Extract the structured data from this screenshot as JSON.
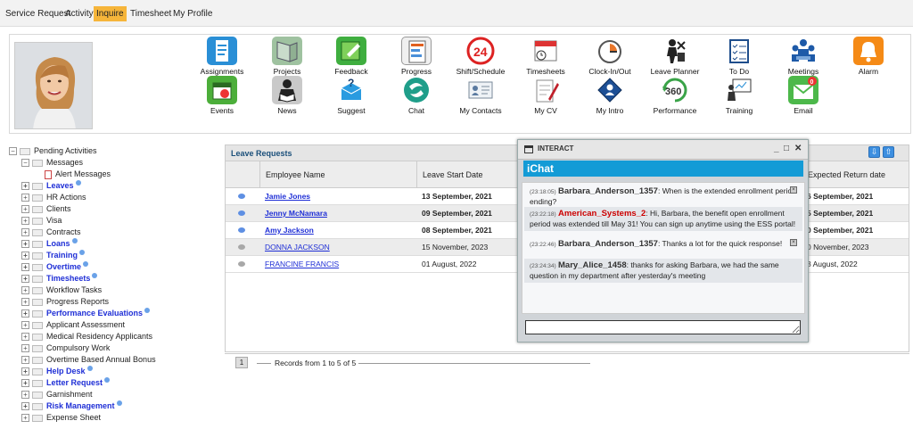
{
  "topnav": {
    "items": [
      "Service Request",
      "Activity",
      "Inquire",
      "Timesheet",
      "My Profile"
    ],
    "active_index": 2
  },
  "dashboard": {
    "row1": [
      "Assignments",
      "Projects",
      "Feedback",
      "Progress",
      "Shift/Schedule",
      "Timesheets",
      "Clock-In/Out",
      "Leave Planner",
      "To Do",
      "Meetings",
      "Alarm"
    ],
    "row2": [
      "Events",
      "News",
      "Suggest",
      "Chat",
      "My Contacts",
      "My CV",
      "My Intro",
      "Performance",
      "Training",
      "Email"
    ],
    "email_badge": "0",
    "performance_badge": "360"
  },
  "tree": {
    "root": "Pending Activities",
    "messages": "Messages",
    "alert_messages": "Alert Messages",
    "items": [
      {
        "label": "Leaves",
        "bold": true
      },
      {
        "label": "HR Actions",
        "bold": false
      },
      {
        "label": "Clients",
        "bold": false
      },
      {
        "label": "Visa",
        "bold": false
      },
      {
        "label": "Contracts",
        "bold": false
      },
      {
        "label": "Loans",
        "bold": true
      },
      {
        "label": "Training",
        "bold": true
      },
      {
        "label": "Overtime",
        "bold": true
      },
      {
        "label": "Timesheets",
        "bold": true
      },
      {
        "label": "Workflow Tasks",
        "bold": false
      },
      {
        "label": "Progress Reports",
        "bold": false
      },
      {
        "label": "Performance Evaluations",
        "bold": true
      },
      {
        "label": "Applicant Assessment",
        "bold": false
      },
      {
        "label": "Medical Residency Applicants",
        "bold": false
      },
      {
        "label": "Compulsory Work",
        "bold": false
      },
      {
        "label": "Overtime Based Annual Bonus",
        "bold": false
      },
      {
        "label": "Help Desk",
        "bold": true
      },
      {
        "label": "Letter Request",
        "bold": true
      },
      {
        "label": "Garnishment",
        "bold": false
      },
      {
        "label": "Risk Management",
        "bold": true
      },
      {
        "label": "Expense Sheet",
        "bold": false
      }
    ]
  },
  "grid": {
    "title": "Leave Requests",
    "columns": [
      "Employee Name",
      "Leave Start Date",
      "Expected Return date"
    ],
    "rows": [
      {
        "name": "Jamie Jones",
        "start": "13 September, 2021",
        "return": "6 September, 2021",
        "bold": true,
        "status": "new"
      },
      {
        "name": "Jenny McNamara",
        "start": "09 September, 2021",
        "return": "5 September, 2021",
        "bold": true,
        "status": "new"
      },
      {
        "name": "Amy Jackson",
        "start": "08 September, 2021",
        "return": "0 September, 2021",
        "bold": true,
        "status": "new"
      },
      {
        "name": "DONNA JACKSON",
        "start": "15 November, 2023",
        "return": "0 November, 2023",
        "bold": false,
        "status": "read"
      },
      {
        "name": "FRANCINE FRANCIS",
        "start": "01 August, 2022",
        "return": "3 August, 2022",
        "bold": false,
        "status": "read"
      }
    ],
    "page": "1",
    "records_text": "Records from 1 to 5 of 5"
  },
  "chat": {
    "window_title": "INTERACT",
    "header": "iChat",
    "messages": [
      {
        "time": "(23:18:05)",
        "user": "Barbara_Anderson_1357",
        "agent": false,
        "text": ": When is the extended enrollment period ending?"
      },
      {
        "time": "(23:22:18)",
        "user": "American_Systems_2",
        "agent": true,
        "text": ": Hi, Barbara, the benefit open enrollment period was extended till May 31! You can sign up anytime using the ESS portal!"
      },
      {
        "time": "(23:22:46)",
        "user": "Barbara_Anderson_1357",
        "agent": false,
        "text": ": Thanks a lot for the quick response!"
      },
      {
        "time": "(23:24:34)",
        "user": "Mary_Alice_1458",
        "agent": false,
        "text": ": thanks for asking Barbara, we had the same question in my department after yesterday's meeting"
      }
    ]
  },
  "colors": {
    "active_tab": "#f6b53a",
    "link_blue": "#1f2fd6",
    "chat_header": "#139bd6",
    "agent_red": "#cc0000"
  }
}
